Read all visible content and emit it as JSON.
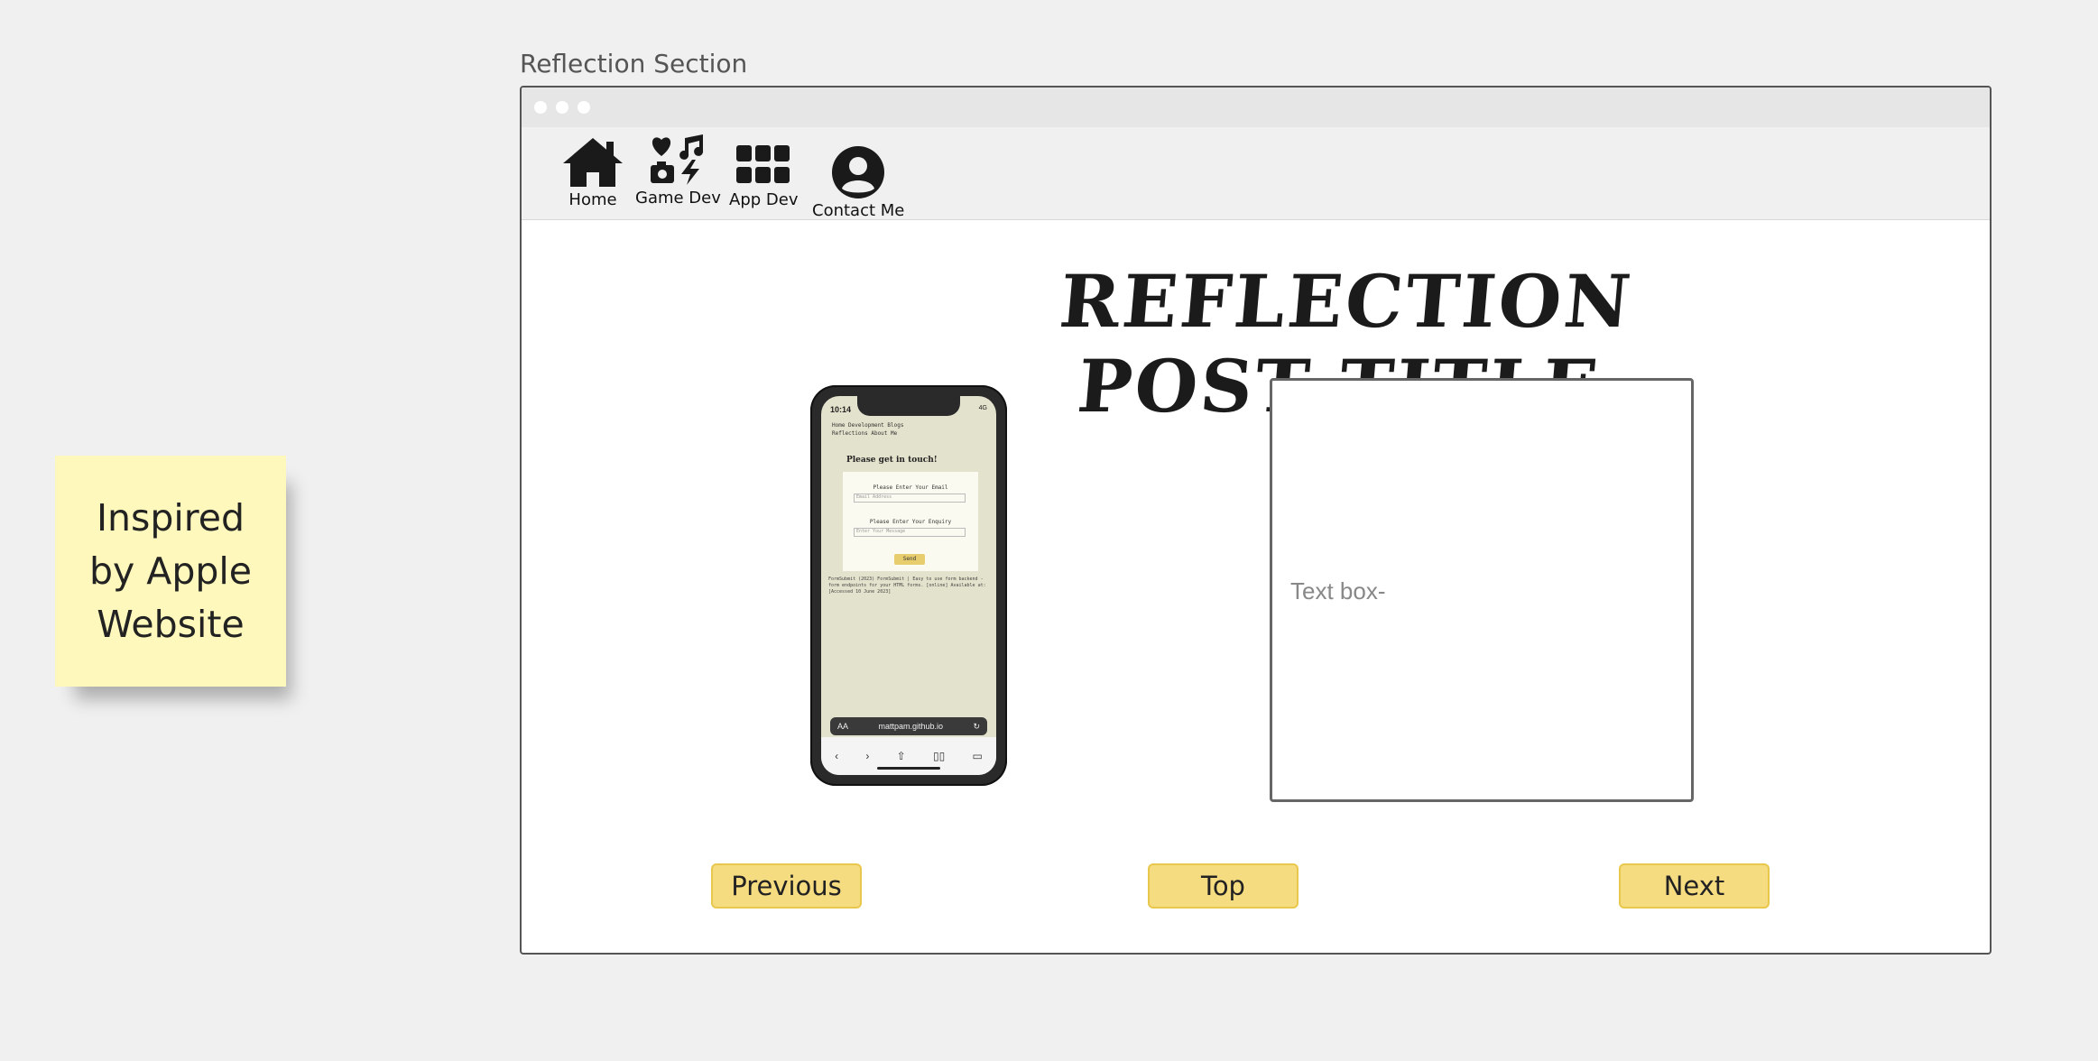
{
  "section_label": "Reflection Section",
  "sticky_note": {
    "text": "Inspired\nby Apple\nWebsite"
  },
  "nav": {
    "items": [
      {
        "label": "Home",
        "icon": "home-icon"
      },
      {
        "label": "Game Dev",
        "icon": "media-collage-icon"
      },
      {
        "label": "App Dev",
        "icon": "grid-apps-icon"
      },
      {
        "label": "Contact Me",
        "icon": "user-circle-icon"
      }
    ]
  },
  "post": {
    "title": "REFLECTION POST TITLE",
    "textbox_placeholder": "Text box-"
  },
  "phone_preview": {
    "time": "10:14",
    "status": "4G",
    "nav_line1": "Home   Development   Blogs",
    "nav_line2": "Reflections   About Me",
    "heading": "Please get in touch!",
    "email_label": "Please Enter Your Email",
    "email_placeholder": "Email Address",
    "enquiry_label": "Please Enter Your Enquiry",
    "enquiry_placeholder": "Enter Your Message",
    "send_label": "Send",
    "footer": "FormSubmit (2023) FormSubmit | Easy to use form backend - form endpoints for your HTML forms. [online] Available at: [Accessed 10 June 2023]",
    "url": "mattpam.github.io",
    "url_prefix": "AA"
  },
  "buttons": {
    "previous": "Previous",
    "top": "Top",
    "next": "Next"
  },
  "colors": {
    "button_fill": "#f6dc80",
    "button_border": "#e8c84c",
    "sticky_note": "#fef8bc",
    "page_bg": "#f0f0f0"
  }
}
